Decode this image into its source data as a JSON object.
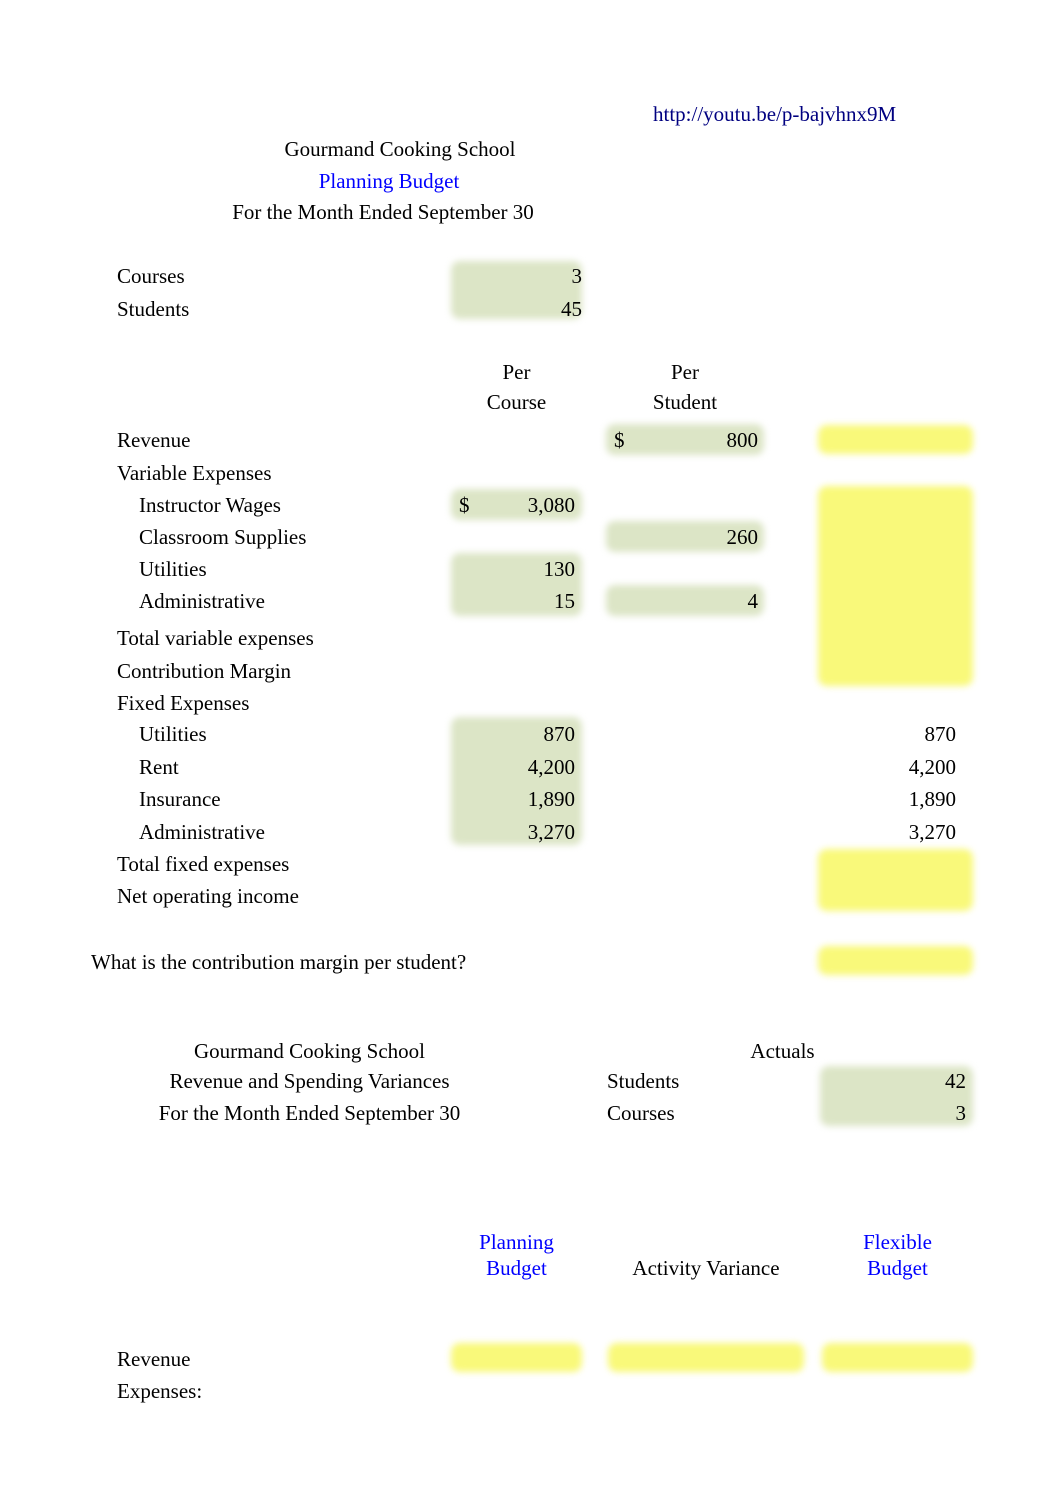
{
  "document": {
    "type": "spreadsheet-worksheet",
    "link": {
      "text": "http://youtu.be/p-bajvhnx9M",
      "color": "#000080"
    },
    "colors": {
      "input_highlight_green": "#dce5c6",
      "answer_highlight_yellow": "#f9f97a",
      "heading_blue": "#0000ff"
    }
  },
  "planning_budget": {
    "title_line1": "Gourmand Cooking School",
    "title_line2": "Planning Budget",
    "title_line3": "For the Month Ended September 30",
    "activity": {
      "courses_label": "Courses",
      "courses_value": "3",
      "students_label": "Students",
      "students_value": "45"
    },
    "col_headers": {
      "per_course_line1": "Per",
      "per_course_line2": "Course",
      "per_student_line1": "Per",
      "per_student_line2": "Student"
    },
    "rows": [
      {
        "label": "Revenue",
        "indent": 0,
        "per_course": "",
        "per_student": "800",
        "per_student_dollar": "$",
        "total": ""
      },
      {
        "label": "Variable Expenses",
        "indent": 0,
        "per_course": "",
        "per_student": "",
        "total": ""
      },
      {
        "label": "Instructor Wages",
        "indent": 1,
        "per_course": "3,080",
        "per_course_dollar": "$",
        "per_student": "",
        "total": ""
      },
      {
        "label": "Classroom Supplies",
        "indent": 1,
        "per_course": "",
        "per_student": "260",
        "total": ""
      },
      {
        "label": "Utilities",
        "indent": 1,
        "per_course": "130",
        "per_student": "",
        "total": ""
      },
      {
        "label": "Administrative",
        "indent": 1,
        "per_course": "15",
        "per_student": "4",
        "total": ""
      },
      {
        "label": "Total variable expenses",
        "indent": 0,
        "per_course": "",
        "per_student": "",
        "total": ""
      },
      {
        "label": "Contribution Margin",
        "indent": 0,
        "per_course": "",
        "per_student": "",
        "total": ""
      },
      {
        "label": "Fixed Expenses",
        "indent": 0,
        "per_course": "",
        "per_student": "",
        "total": ""
      },
      {
        "label": "Utilities",
        "indent": 1,
        "per_course": "870",
        "per_student": "",
        "total": "870"
      },
      {
        "label": "Rent",
        "indent": 1,
        "per_course": "4,200",
        "per_student": "",
        "total": "4,200"
      },
      {
        "label": "Insurance",
        "indent": 1,
        "per_course": "1,890",
        "per_student": "",
        "total": "1,890"
      },
      {
        "label": "Administrative",
        "indent": 1,
        "per_course": "3,270",
        "per_student": "",
        "total": "3,270"
      },
      {
        "label": "Total fixed expenses",
        "indent": 0,
        "per_course": "",
        "per_student": "",
        "total": ""
      },
      {
        "label": "Net operating income",
        "indent": 0,
        "per_course": "",
        "per_student": "",
        "total": ""
      }
    ],
    "question": {
      "text": "What is the contribution margin per student?",
      "answer": ""
    }
  },
  "variance_report": {
    "title_line1": "Gourmand Cooking School",
    "title_line2": "Revenue and Spending Variances",
    "title_line3": "For the Month Ended September 30",
    "actuals": {
      "heading": "Actuals",
      "students_label": "Students",
      "students_value": "42",
      "courses_label": "Courses",
      "courses_value": "3"
    },
    "col_headers": {
      "planning_budget_line1": "Planning",
      "planning_budget_line2": "Budget",
      "activity_variance": "Activity Variance",
      "flexible_budget_line1": "Flexible",
      "flexible_budget_line2": "Budget"
    },
    "rows": [
      {
        "label": "Revenue",
        "planning_budget": "",
        "activity_variance": "",
        "flexible_budget": ""
      },
      {
        "label": "Expenses:",
        "planning_budget": "",
        "activity_variance": "",
        "flexible_budget": ""
      }
    ]
  }
}
